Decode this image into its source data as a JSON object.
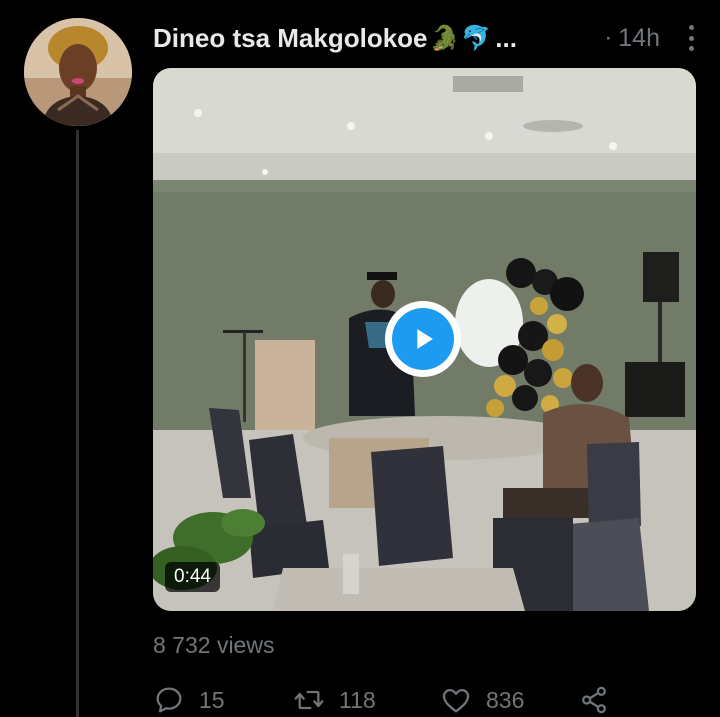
{
  "tweet": {
    "display_name": "Dineo tsa Makgolokoe",
    "name_emojis": [
      "🐊",
      "🐬"
    ],
    "name_truncation": "...",
    "separator": "·",
    "time": "14h",
    "more_icon": "more-vertical-icon",
    "media": {
      "type": "video",
      "duration": "0:44",
      "play_icon": "play-icon"
    },
    "views": "8 732 views",
    "actions": {
      "reply_count": "15",
      "retweet_count": "118",
      "like_count": "836",
      "reply_icon": "reply-icon",
      "retweet_icon": "retweet-icon",
      "like_icon": "heart-icon",
      "share_icon": "share-icon"
    }
  },
  "colors": {
    "background": "#000000",
    "primary_text": "#e7e9ea",
    "secondary_text": "#71767b",
    "accent": "#1d9bf0",
    "divider": "#2f3336"
  }
}
